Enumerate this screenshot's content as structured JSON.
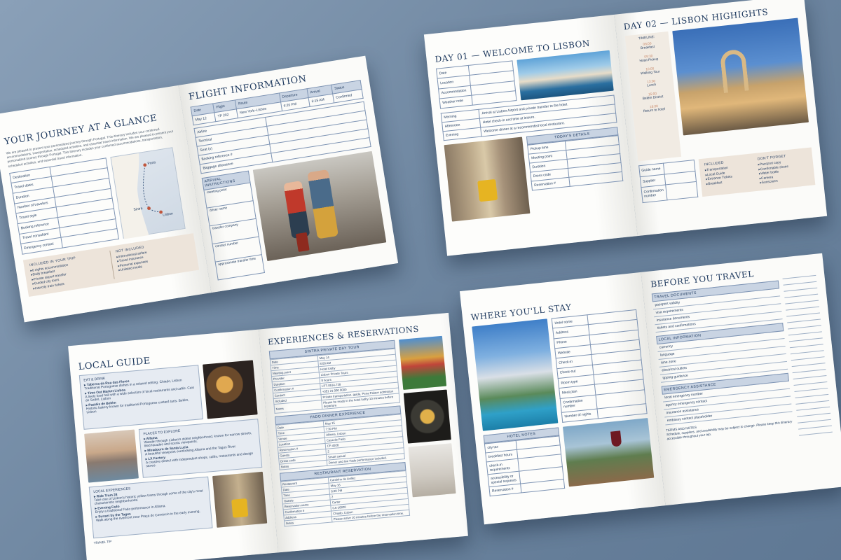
{
  "journey": {
    "title": "YOUR JOURNEY AT A GLANCE",
    "intro": "We are pleased to present your personalized journey through Portugal. This itinerary includes your confirmed accommodations, transportation, scheduled activities, and essential travel information. We are pleased to present your personalized journey through Portugal. This itinerary includes your confirmed accommodations, transportation, scheduled activities, and essential travel information.",
    "fields": [
      "Destination",
      "Travel dates",
      "Duration",
      "Number of travelers",
      "Travel style",
      "Booking reference",
      "Travel consultant",
      "Emergency contact"
    ],
    "map_labels": [
      "Porto",
      "Sintra",
      "Lisbon"
    ],
    "included_title": "INCLUDED IN YOUR TRIP",
    "included": [
      "6 nights accommodation",
      "Daily breakfast",
      "Private airport transfer",
      "Guided city tours",
      "Intercity train tickets"
    ],
    "not_included_title": "NOT INCLUDED",
    "not_included": [
      "International airfare",
      "Travel insurance",
      "Personal expenses",
      "Unlisted meals"
    ]
  },
  "flight": {
    "title": "FLIGHT INFORMATION",
    "columns": [
      "Date",
      "Flight",
      "Route",
      "Departure",
      "Arrival",
      "Status"
    ],
    "row": [
      "May 12",
      "TP 202",
      "New York–Lisbon",
      "6:20 PM",
      "6:15 AM",
      "Confirmed"
    ],
    "fields": [
      "Airline",
      "Terminal",
      "Seat (s)",
      "Booking reference #",
      "Baggage allowance"
    ],
    "arrival_title": "ARRIVAL INSTRUCTIONS",
    "arrival_fields": [
      "meeting point",
      "driver name",
      "transfer company",
      "contact number",
      "approximate transfer time"
    ]
  },
  "day1": {
    "title": "DAY 01 — WELCOME TO LISBON",
    "fields": [
      "Date",
      "Location",
      "Accommodation",
      "Weather note"
    ],
    "schedule": [
      {
        "label": "Morning",
        "text": "Arrival at Lisbon Airport and private transfer to the hotel."
      },
      {
        "label": "Afternoon",
        "text": "Hotel check-in and time at leisure."
      },
      {
        "label": "Evening",
        "text": "Welcome dinner at a recommended local restaurant."
      }
    ],
    "today_title": "TODAY'S DETAILS",
    "today_fields": [
      "Pickup time",
      "Meeting point",
      "Duration",
      "Dress code",
      "Reservation #"
    ]
  },
  "day2": {
    "title": "DAY 02 — LISBON HIGHIGHTS",
    "timeline_title": "TIMELINE:",
    "timeline": [
      {
        "time": "08:00",
        "label": "Breakfast"
      },
      {
        "time": "09:30",
        "label": "Hotel Pickup"
      },
      {
        "time": "10:00",
        "label": "Walking Tour"
      },
      {
        "time": "13:00",
        "label": "Lunch"
      },
      {
        "time": "15:00",
        "label": "Belém District"
      },
      {
        "time": "18:00",
        "label": "Return to hotel"
      }
    ],
    "fields": [
      "Guide name",
      "Supplier",
      "Confirmation number"
    ],
    "included_title": "INCLUDED",
    "included": [
      "Transportation",
      "Local Guide",
      "Entrance Tickets",
      "Breakfast"
    ],
    "forget_title": "DON'T FORGET",
    "forget": [
      "Passport copy",
      "Comfortable shoes",
      "Water bottle",
      "Camera",
      "Sunscreen"
    ]
  },
  "guide": {
    "title": "LOCAL GUIDE",
    "eat_title": "EAT & DRINK",
    "eat": [
      {
        "name": "Taberna da Rua das Flores",
        "desc": "Traditional Portuguese dishes in a relaxed setting. Chiado, Lisbon"
      },
      {
        "name": "Time Out Market Lisboa",
        "desc": "A lively food hall with a wide selection of local restaurants and cafés. Cais do Sodré, Lisbon"
      },
      {
        "name": "Pastéis de Belém",
        "desc": "Historic bakery known for traditional Portuguese custard tarts. Belém, Lisbon"
      }
    ],
    "places_title": "PLACES TO EXPLORE",
    "places": [
      {
        "name": "Alfama",
        "desc": "Wander through Lisbon's oldest neighborhood, known for narrow streets, tiled facades and scenic viewpoints."
      },
      {
        "name": "Miradouro de Santa Luzia",
        "desc": "A beautiful viewpoint overlooking Alfama and the Tagus River."
      },
      {
        "name": "LX Factory",
        "desc": "A creative district with independent shops, cafés, restaurants and design stores."
      }
    ],
    "exp_title": "LOCAL EXPERIENCES",
    "exp": [
      {
        "name": "Ride Tram 28",
        "desc": "Take one of Lisbon's historic yellow trams through some of the city's most characteristic neighborhoods."
      },
      {
        "name": "Evening Fado",
        "desc": "Enjoy a traditional Fado performance in Alfama."
      },
      {
        "name": "Sunset by the Tagus",
        "desc": "Walk along the riverfront near Praça do Comércio in the early evening."
      }
    ],
    "tip_label": "TRAVEL TIP"
  },
  "experiences": {
    "title": "EXPERIENCES & RESERVATIONS",
    "tables": [
      {
        "title": "SINTRA PRIVATE DAY TOUR",
        "rows": [
          [
            "Date",
            "May 14"
          ],
          [
            "Time",
            "8:00 AM"
          ],
          [
            "Meeting point",
            "Hotel lobby"
          ],
          [
            "Provider",
            "Lisbon Private Tours"
          ],
          [
            "Duration",
            "8 hours"
          ],
          [
            "Confirmation #",
            "LPT-0514-728"
          ],
          [
            "Contact",
            "+351 21 000 0000"
          ],
          [
            "Included",
            "Private transportation, guide, Pena Palace admission"
          ],
          [
            "Notes",
            "Please be ready in the hotel lobby 10 minutes before departure."
          ]
        ]
      },
      {
        "title": "FADO DINNER EXPERIENCE",
        "rows": [
          [
            "Date",
            "May 15"
          ],
          [
            "Time",
            "7:30 PM"
          ],
          [
            "Venue",
            "Alfama, Lisbon"
          ],
          [
            "Location",
            "Casa de Fado"
          ],
          [
            "Reservation #",
            "CF-4928"
          ],
          [
            "Guests",
            "2"
          ],
          [
            "Dress code",
            "Smart casual"
          ],
          [
            "Notes",
            "Dinner and live Fado performance included."
          ]
        ]
      },
      {
        "title": "RESTAURANT RESERVATION",
        "rows": [
          [
            "Restaurant",
            "Cantinho do Avillez"
          ],
          [
            "Date",
            "May 16"
          ],
          [
            "Time",
            "8:00 PM"
          ],
          [
            "Guests",
            "2"
          ],
          [
            "Reservation name",
            "Carter"
          ],
          [
            "Confirmation #",
            "CA-16820"
          ],
          [
            "Address",
            "Chiado, Lisbon"
          ],
          [
            "Notes",
            "Please arrive 10 minutes before the reservation time."
          ]
        ]
      }
    ]
  },
  "stay": {
    "title": "WHERE YOU'LL STAY",
    "fields": [
      "Hotel name",
      "Address",
      "Phone",
      "Website",
      "Check-in",
      "Check-out",
      "Room type",
      "Meal plan",
      "Confirmation number",
      "Number of nights"
    ],
    "notes_title": "HOTEL NOTES",
    "notes_fields": [
      "city tax",
      "breakfast hours",
      "check-in requirements",
      "accessibility or special requests",
      "Reservation #"
    ]
  },
  "before": {
    "title": "BEFORE YOU TRAVEL",
    "docs_title": "TRAVEL DOCUMENTS",
    "docs": [
      "passport validity",
      "visa requirements",
      "insurance documents",
      "tickets and confirmations"
    ],
    "local_title": "LOCAL INFORMATION",
    "local": [
      "currency",
      "language",
      "time zone",
      "electrical outlets",
      "tipping guidance"
    ],
    "emergency_title": "EMERGENCY ASSISTANCE",
    "emergency": [
      "local emergency number",
      "agency emergency contact",
      "insurance assistance",
      "embassy contact placeholder"
    ],
    "terms_title": "TERMS AND NOTES",
    "terms": "Schedule, suppliers, and availability may be subject to change. Please keep this itinerary accessible throughout your trip."
  },
  "colors": {
    "navy": "#1f3a5f",
    "beige": "#ede4da",
    "light_blue": "#c9d4e3",
    "background": "#7890aa"
  }
}
